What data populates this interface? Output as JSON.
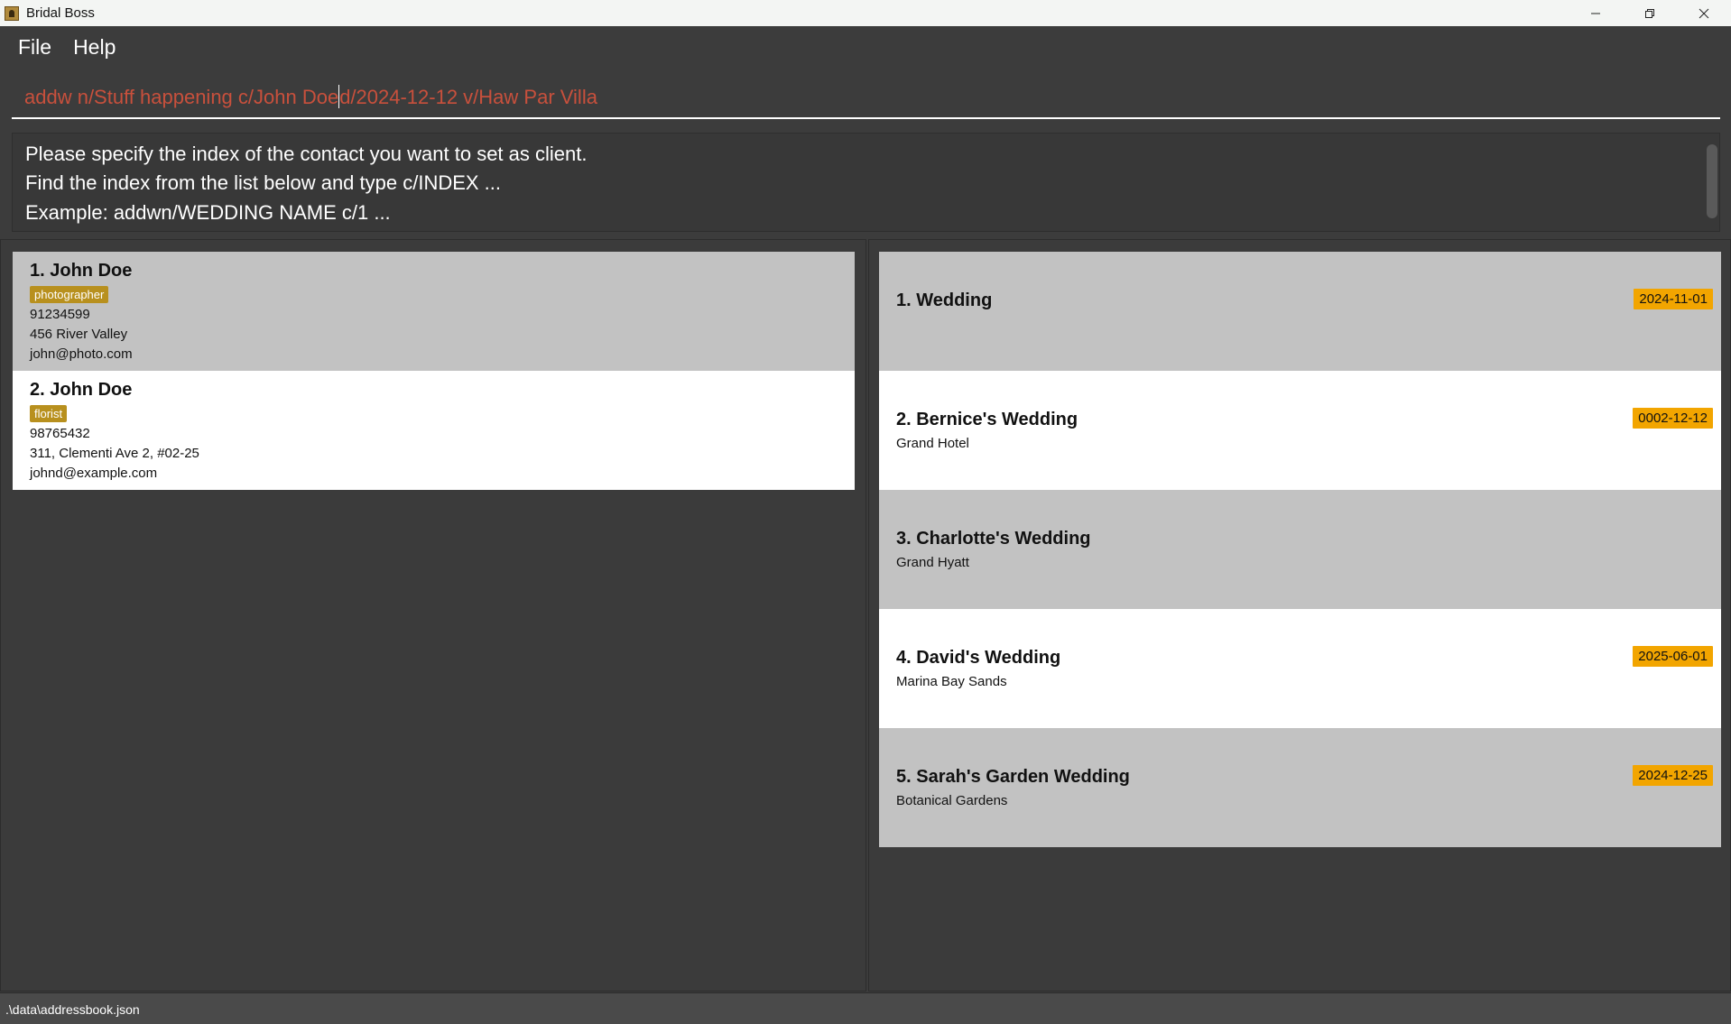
{
  "window": {
    "title": "Bridal Boss",
    "icon": "bride-icon",
    "controls": [
      "minimize-icon",
      "restore-icon",
      "close-icon"
    ]
  },
  "menu": {
    "items": [
      {
        "label": "File"
      },
      {
        "label": "Help"
      }
    ]
  },
  "command": {
    "before_caret": "addw n/Stuff happening c/John Doe",
    "after_caret": "d/2024-12-12 v/Haw Par Villa",
    "text_color": "#c8503c"
  },
  "result": {
    "lines": [
      "Please specify the index of the contact you want to set as client.",
      "Find the index from the list below and type c/INDEX ...",
      "Example: addwn/WEDDING NAME c/1 ..."
    ]
  },
  "persons": [
    {
      "name": "1. John Doe",
      "tag": "photographer",
      "phone": "91234599",
      "address": "456 River Valley",
      "email": "john@photo.com"
    },
    {
      "name": "2. John Doe",
      "tag": "florist",
      "phone": "98765432",
      "address": "311, Clementi Ave 2, #02-25",
      "email": "johnd@example.com"
    }
  ],
  "weddings": [
    {
      "name": "1. Wedding",
      "venue": "",
      "date": "2024-11-01"
    },
    {
      "name": "2. Bernice's Wedding",
      "venue": "Grand Hotel",
      "date": "0002-12-12"
    },
    {
      "name": "3. Charlotte's Wedding",
      "venue": "Grand Hyatt",
      "date": ""
    },
    {
      "name": "4. David's Wedding",
      "venue": "Marina Bay Sands",
      "date": "2025-06-01"
    },
    {
      "name": "5. Sarah's Garden Wedding",
      "venue": "Botanical Gardens",
      "date": "2024-12-25"
    }
  ],
  "status": {
    "file_path": ".\\data\\addressbook.json"
  },
  "colors": {
    "background": "#3c3c3c",
    "tag": "#b8901e",
    "date_badge": "#f2a500",
    "card_grey": "#c2c2c2",
    "card_white": "#ffffff"
  }
}
